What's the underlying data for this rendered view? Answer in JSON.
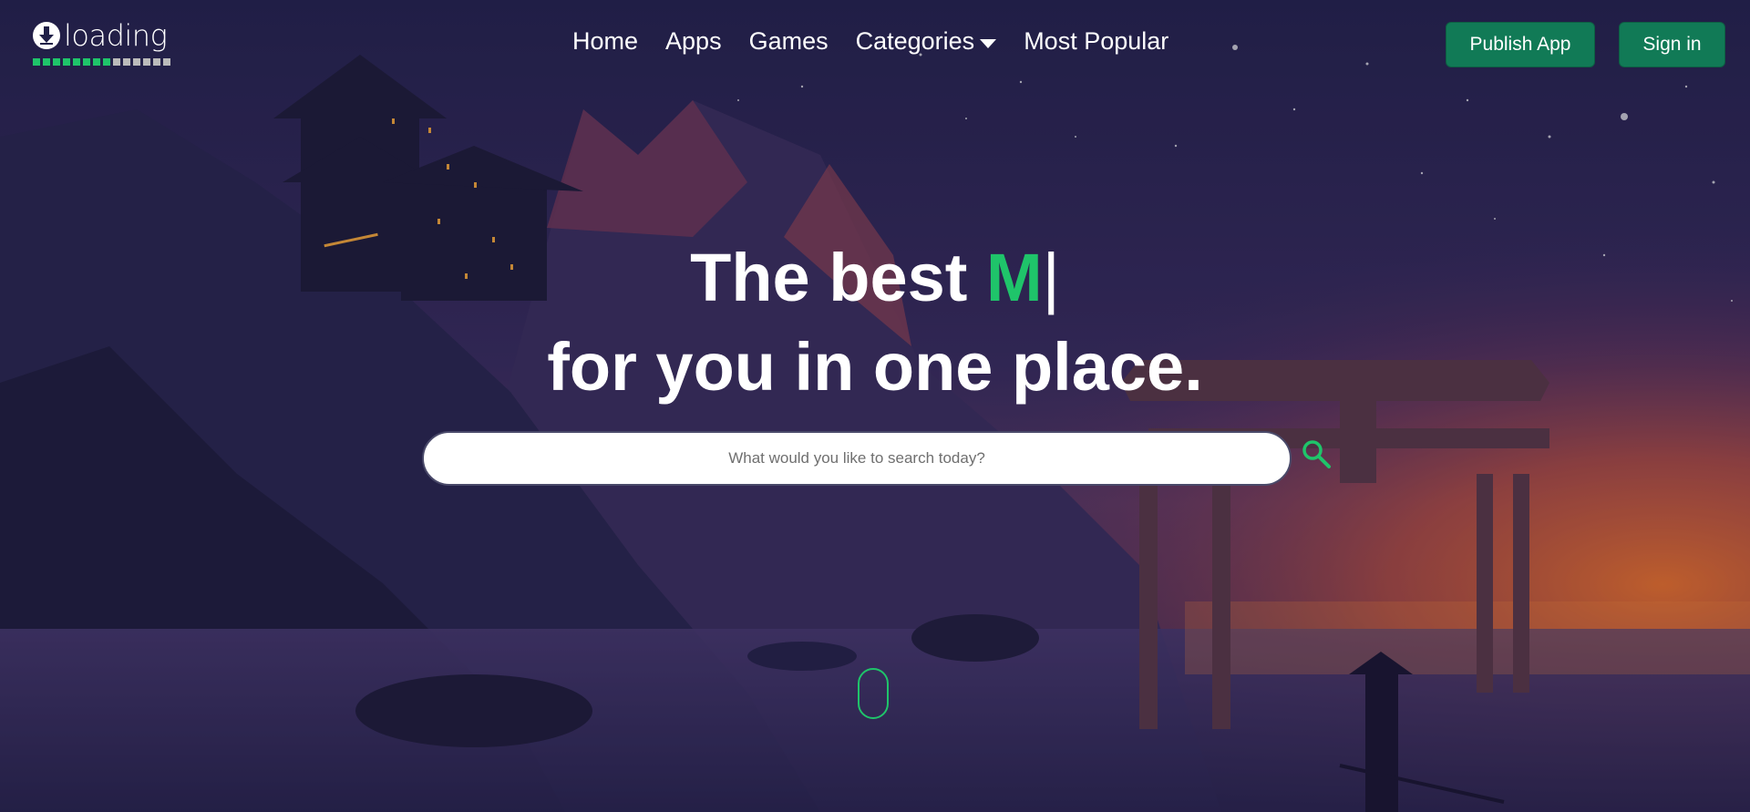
{
  "header": {
    "logo_text": "loading",
    "nav": [
      {
        "label": "Home"
      },
      {
        "label": "Apps"
      },
      {
        "label": "Games"
      },
      {
        "label": "Categories"
      },
      {
        "label": "Most Popular"
      }
    ],
    "publish_label": "Publish App",
    "signin_label": "Sign in"
  },
  "hero": {
    "line1_prefix": "The best ",
    "line1_accent": "M",
    "line1_cursor": "|",
    "line2": "for you in one place."
  },
  "search": {
    "placeholder": "What would you like to search today?"
  },
  "colors": {
    "accent": "#1fc46a",
    "button": "#117a56"
  }
}
